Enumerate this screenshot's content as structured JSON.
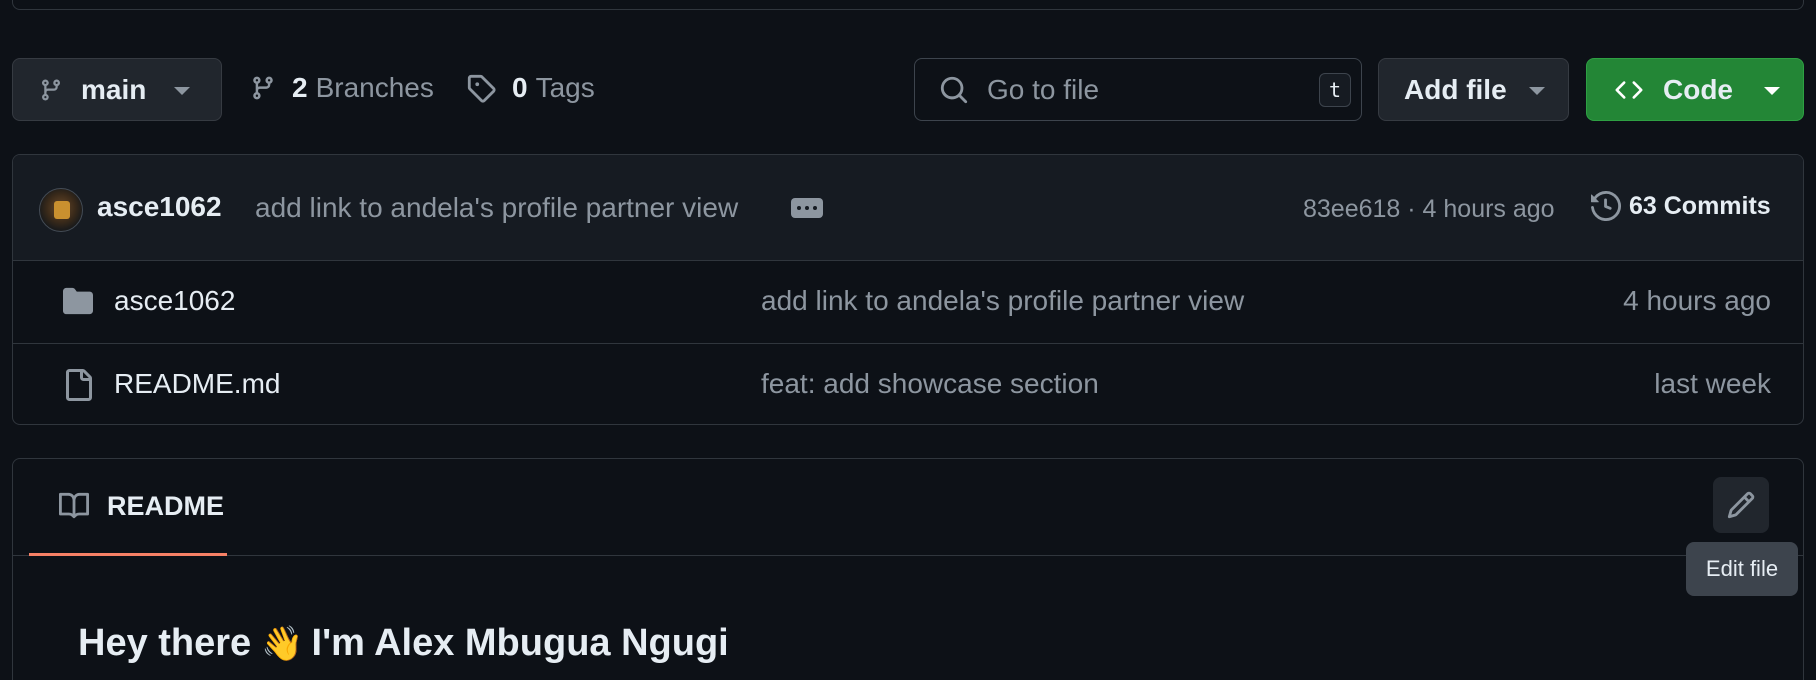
{
  "toolbar": {
    "branch": "main",
    "branches_count": "2",
    "branches_label": "Branches",
    "tags_count": "0",
    "tags_label": "Tags",
    "search_placeholder": "Go to file",
    "search_shortcut": "t",
    "add_file_label": "Add file",
    "code_label": "Code"
  },
  "latest_commit": {
    "author": "asce1062",
    "message": "add link to andela's profile partner view",
    "hash_time": "83ee618 · 4 hours ago",
    "commits_label": "63 Commits"
  },
  "files": [
    {
      "icon": "folder-icon",
      "name": "asce1062",
      "message": "add link to andela's profile partner view",
      "time": "4 hours ago"
    },
    {
      "icon": "file-icon",
      "name": "README.md",
      "message": "feat: add showcase section",
      "time": "last week"
    }
  ],
  "readme": {
    "tab_label": "README",
    "edit_tooltip": "Edit file",
    "heading_before": "Hey there",
    "heading_emoji": "👋",
    "heading_after": "I'm Alex Mbugua Ngugi"
  },
  "colors": {
    "background": "#0d1117",
    "code_button": "#238636",
    "tab_underline": "#f78166"
  }
}
